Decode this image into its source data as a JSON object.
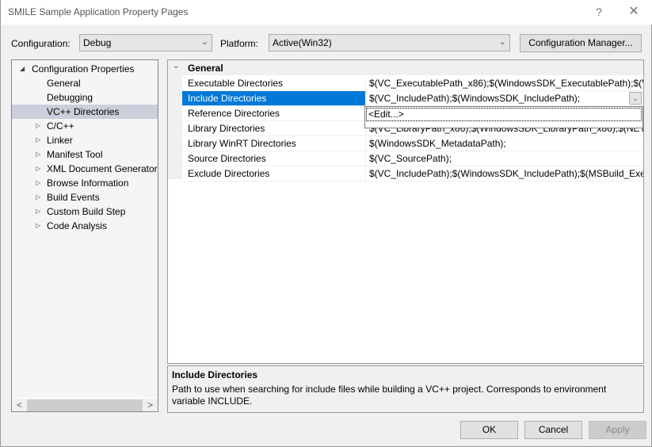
{
  "window": {
    "title": "SMILE Sample Application Property Pages",
    "help_label": "?",
    "close_label": "✕"
  },
  "toolbar": {
    "configuration_label": "Configuration:",
    "configuration_value": "Debug",
    "platform_label": "Platform:",
    "platform_value": "Active(Win32)",
    "config_manager_label": "Configuration Manager..."
  },
  "tree": {
    "root": {
      "label": "Configuration Properties",
      "glyph": "◢"
    },
    "items": [
      {
        "label": "General",
        "expandable": false,
        "selected": false
      },
      {
        "label": "Debugging",
        "expandable": false,
        "selected": false
      },
      {
        "label": "VC++ Directories",
        "expandable": false,
        "selected": true
      },
      {
        "label": "C/C++",
        "expandable": true,
        "selected": false
      },
      {
        "label": "Linker",
        "expandable": true,
        "selected": false
      },
      {
        "label": "Manifest Tool",
        "expandable": true,
        "selected": false
      },
      {
        "label": "XML Document Generator",
        "expandable": true,
        "selected": false
      },
      {
        "label": "Browse Information",
        "expandable": true,
        "selected": false
      },
      {
        "label": "Build Events",
        "expandable": true,
        "selected": false
      },
      {
        "label": "Custom Build Step",
        "expandable": true,
        "selected": false
      },
      {
        "label": "Code Analysis",
        "expandable": true,
        "selected": false
      }
    ],
    "expand_glyph": "▷",
    "scroll_left": "<",
    "scroll_right": ">"
  },
  "grid": {
    "category": "General",
    "category_glyph": "⌄",
    "rows": [
      {
        "name": "Executable Directories",
        "value": "$(VC_ExecutablePath_x86);$(WindowsSDK_ExecutablePath);$(VS_ExecutablePath)"
      },
      {
        "name": "Include Directories",
        "value": "$(VC_IncludePath);$(WindowsSDK_IncludePath);",
        "selected": true
      },
      {
        "name": "Reference Directories",
        "value": ""
      },
      {
        "name": "Library Directories",
        "value": "$(VC_LibraryPath_x86);$(WindowsSDK_LibraryPath_x86);$(NETFXKitsDir)"
      },
      {
        "name": "Library WinRT Directories",
        "value": "$(WindowsSDK_MetadataPath);"
      },
      {
        "name": "Source Directories",
        "value": "$(VC_SourcePath);"
      },
      {
        "name": "Exclude Directories",
        "value": "$(VC_IncludePath);$(WindowsSDK_IncludePath);$(MSBuild_ExecutablePath)"
      }
    ],
    "dropdown_glyph": "⌄",
    "dropdown_items": [
      "<Edit...>"
    ]
  },
  "description": {
    "title": "Include Directories",
    "text": "Path to use when searching for include files while building a VC++ project.  Corresponds to environment variable INCLUDE."
  },
  "buttons": {
    "ok": "OK",
    "cancel": "Cancel",
    "apply": "Apply"
  }
}
